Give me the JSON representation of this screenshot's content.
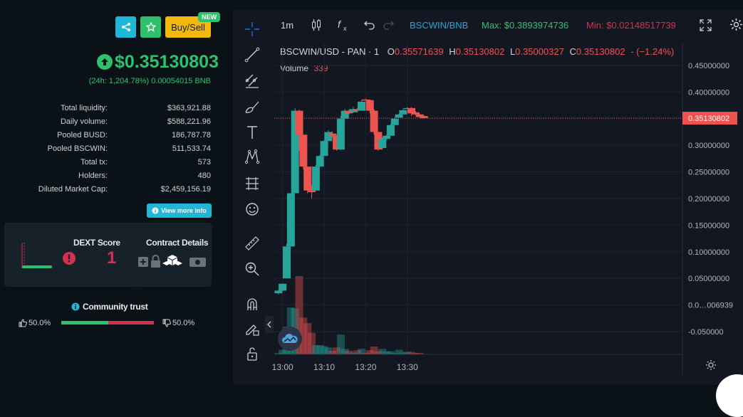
{
  "header": {
    "buy_sell_label": "Buy/Sell",
    "new_badge": "NEW",
    "price": "$0.35130803",
    "change_24h": "(24h: 1,204.78%) 0.00054015 BNB"
  },
  "stats": [
    {
      "label": "Total liquidity:",
      "value": "$363,921.88"
    },
    {
      "label": "Daily volume:",
      "value": "$588,221.96"
    },
    {
      "label": "Pooled BUSD:",
      "value": "186,787.78"
    },
    {
      "label": "Pooled BSCWIN:",
      "value": "511,533.74"
    },
    {
      "label": "Total tx:",
      "value": "573"
    },
    {
      "label": "Holders:",
      "value": "480"
    },
    {
      "label": "Diluted Market Cap:",
      "value": "$2,459,156.19"
    }
  ],
  "view_more_label": "View more info",
  "dext": {
    "title": "DEXT Score",
    "score": "1"
  },
  "contract": {
    "title": "Contract Details"
  },
  "community": {
    "title": "Community trust",
    "up_pct": "50.0%",
    "down_pct": "50.0%",
    "up_fraction": 0.5
  },
  "toolbar": {
    "interval": "1m",
    "pair": "BSCWIN/BNB",
    "max": "Max: $0.3893974736",
    "min": "Min: $0.02148517739"
  },
  "legend": {
    "symbol": "BSCWIN/USD - PAN · 1",
    "o_label": "O",
    "o": "0.35571639",
    "h_label": "H",
    "h": "0.35130802",
    "l_label": "L",
    "l": "0.35000327",
    "c_label": "C",
    "c": "0.35130802",
    "change": "- (−1.24%)",
    "volume_label": "Volume",
    "volume": "339"
  },
  "colors": {
    "up": "#26a69a",
    "down": "#ef5350",
    "accent": "#20b6d5",
    "green": "#2ec16d",
    "red": "#d5304f"
  },
  "chart_data": {
    "type": "candlestick",
    "y_ticks": [
      "0.45000000",
      "0.40000000",
      "0.35000000",
      "0.30000000",
      "0.25000000",
      "0.20000000",
      "0.15000000",
      "0.10000000",
      "0.05000000",
      "0.0…006939",
      "-0.050000"
    ],
    "x_ticks": [
      "13:00",
      "13:10",
      "13:20",
      "13:30"
    ],
    "current_price_label": "0.35130802",
    "ylim": [
      -0.068,
      0.475
    ],
    "x_minutes_range": [
      12.58,
      13.56
    ],
    "candles": [
      {
        "t": 12.59,
        "o": 0.022,
        "h": 0.028,
        "l": 0.02,
        "c": 0.027,
        "v": 3
      },
      {
        "t": 12.6,
        "o": 0.027,
        "h": 0.04,
        "l": 0.026,
        "c": 0.04,
        "v": 10
      },
      {
        "t": 12.61,
        "o": 0.05,
        "h": 0.115,
        "l": 0.05,
        "c": 0.11,
        "v": 60
      },
      {
        "t": 12.62,
        "o": 0.11,
        "h": 0.21,
        "l": 0.11,
        "c": 0.21,
        "v": 102
      },
      {
        "t": 12.63,
        "o": 0.21,
        "h": 0.37,
        "l": 0.21,
        "c": 0.365,
        "v": 100
      },
      {
        "t": 12.64,
        "o": 0.365,
        "h": 0.367,
        "l": 0.29,
        "c": 0.32,
        "v": 170
      },
      {
        "t": 12.65,
        "o": 0.32,
        "h": 0.32,
        "l": 0.255,
        "c": 0.26,
        "v": 80
      },
      {
        "t": 12.66,
        "o": 0.26,
        "h": 0.26,
        "l": 0.21,
        "c": 0.215,
        "v": 68
      },
      {
        "t": 12.67,
        "o": 0.215,
        "h": 0.225,
        "l": 0.2,
        "c": 0.212,
        "v": 47
      },
      {
        "t": 12.68,
        "o": 0.215,
        "h": 0.263,
        "l": 0.215,
        "c": 0.26,
        "v": 20
      },
      {
        "t": 12.69,
        "o": 0.26,
        "h": 0.282,
        "l": 0.26,
        "c": 0.28,
        "v": 20
      },
      {
        "t": 12.7,
        "o": 0.28,
        "h": 0.31,
        "l": 0.28,
        "c": 0.308,
        "v": 18
      },
      {
        "t": 12.71,
        "o": 0.308,
        "h": 0.328,
        "l": 0.308,
        "c": 0.325,
        "v": 15
      },
      {
        "t": 12.72,
        "o": 0.322,
        "h": 0.326,
        "l": 0.315,
        "c": 0.318,
        "v": 8
      },
      {
        "t": 12.73,
        "o": 0.318,
        "h": 0.32,
        "l": 0.29,
        "c": 0.292,
        "v": 15
      },
      {
        "t": 12.74,
        "o": 0.292,
        "h": 0.355,
        "l": 0.292,
        "c": 0.35,
        "v": 43
      },
      {
        "t": 12.75,
        "o": 0.35,
        "h": 0.368,
        "l": 0.35,
        "c": 0.365,
        "v": 12
      },
      {
        "t": 12.76,
        "o": 0.365,
        "h": 0.368,
        "l": 0.358,
        "c": 0.36,
        "v": 8
      },
      {
        "t": 12.77,
        "o": 0.362,
        "h": 0.372,
        "l": 0.362,
        "c": 0.368,
        "v": 4
      },
      {
        "t": 12.78,
        "o": 0.368,
        "h": 0.37,
        "l": 0.362,
        "c": 0.365,
        "v": 9
      },
      {
        "t": 12.79,
        "o": 0.365,
        "h": 0.385,
        "l": 0.365,
        "c": 0.382,
        "v": 12
      },
      {
        "t": 12.8,
        "o": 0.386,
        "h": 0.388,
        "l": 0.384,
        "c": 0.385,
        "v": 3
      },
      {
        "t": 12.81,
        "o": 0.385,
        "h": 0.386,
        "l": 0.36,
        "c": 0.365,
        "v": 9
      },
      {
        "t": 12.82,
        "o": 0.365,
        "h": 0.368,
        "l": 0.32,
        "c": 0.325,
        "v": 17
      },
      {
        "t": 12.83,
        "o": 0.325,
        "h": 0.325,
        "l": 0.29,
        "c": 0.292,
        "v": 7
      },
      {
        "t": 12.84,
        "o": 0.295,
        "h": 0.315,
        "l": 0.292,
        "c": 0.312,
        "v": 12
      },
      {
        "t": 12.85,
        "o": 0.312,
        "h": 0.32,
        "l": 0.31,
        "c": 0.318,
        "v": 6
      },
      {
        "t": 12.86,
        "o": 0.318,
        "h": 0.34,
        "l": 0.318,
        "c": 0.338,
        "v": 7
      },
      {
        "t": 12.87,
        "o": 0.338,
        "h": 0.352,
        "l": 0.338,
        "c": 0.35,
        "v": 3
      },
      {
        "t": 12.88,
        "o": 0.352,
        "h": 0.36,
        "l": 0.352,
        "c": 0.358,
        "v": 10
      },
      {
        "t": 12.89,
        "o": 0.358,
        "h": 0.368,
        "l": 0.358,
        "c": 0.366,
        "v": 4
      },
      {
        "t": 12.9,
        "o": 0.368,
        "h": 0.372,
        "l": 0.368,
        "c": 0.37,
        "v": 6
      },
      {
        "t": 12.91,
        "o": 0.37,
        "h": 0.372,
        "l": 0.355,
        "c": 0.36,
        "v": 5
      },
      {
        "t": 12.92,
        "o": 0.362,
        "h": 0.364,
        "l": 0.356,
        "c": 0.358,
        "v": 3
      },
      {
        "t": 12.93,
        "o": 0.358,
        "h": 0.359,
        "l": 0.352,
        "c": 0.353,
        "v": 3
      },
      {
        "t": 12.94,
        "o": 0.355,
        "h": 0.356,
        "l": 0.35,
        "c": 0.351,
        "v": 1
      }
    ]
  }
}
